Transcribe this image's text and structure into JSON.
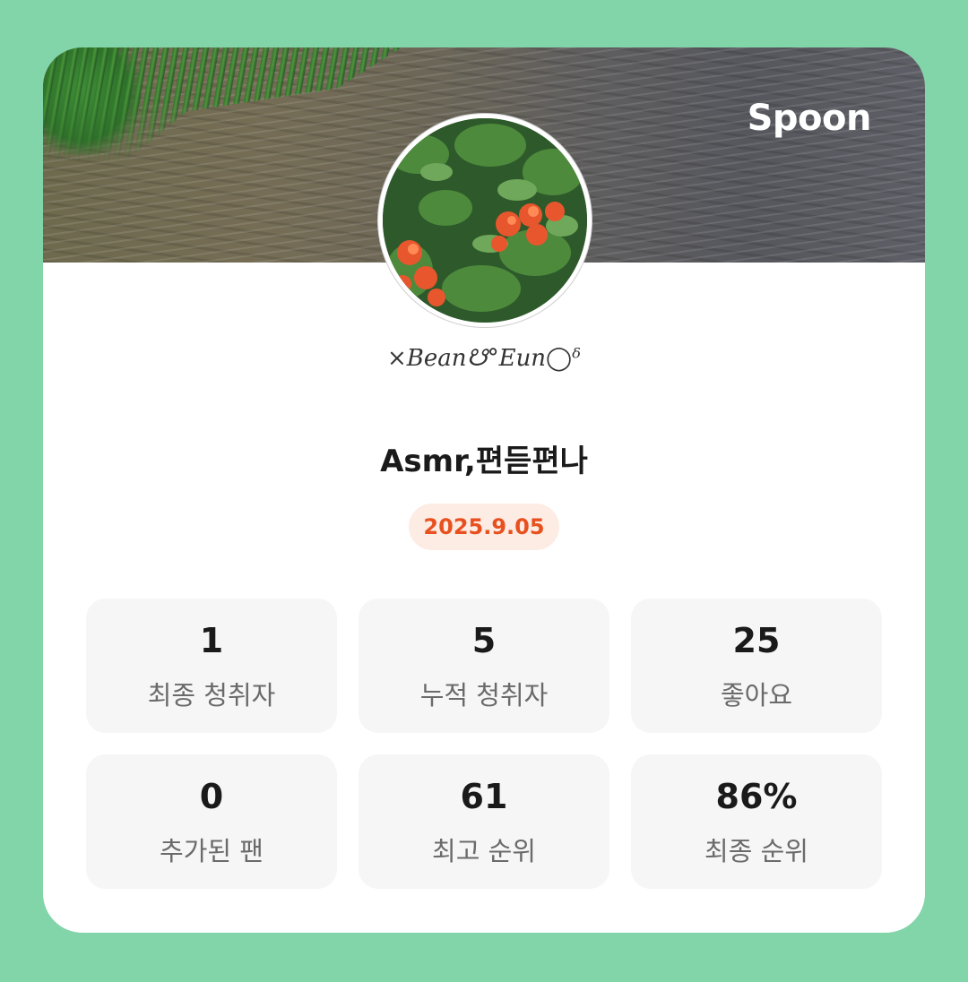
{
  "brand": "Spoon",
  "profile": {
    "nickname": "×Bean☋°Eun◯ᵟ",
    "title": "Asmr,편듣편나",
    "date": "2025.9.05"
  },
  "stats": [
    {
      "value": "1",
      "label": "최종 청취자"
    },
    {
      "value": "5",
      "label": "누적 청취자"
    },
    {
      "value": "25",
      "label": "좋아요"
    },
    {
      "value": "0",
      "label": "추가된 팬"
    },
    {
      "value": "61",
      "label": "최고 순위"
    },
    {
      "value": "86%",
      "label": "최종 순위"
    }
  ],
  "colors": {
    "background": "#82d4a9",
    "card": "#ffffff",
    "date_badge_bg": "#fdece4",
    "date_badge_text": "#e8511f",
    "stat_bg": "#f6f6f6"
  }
}
